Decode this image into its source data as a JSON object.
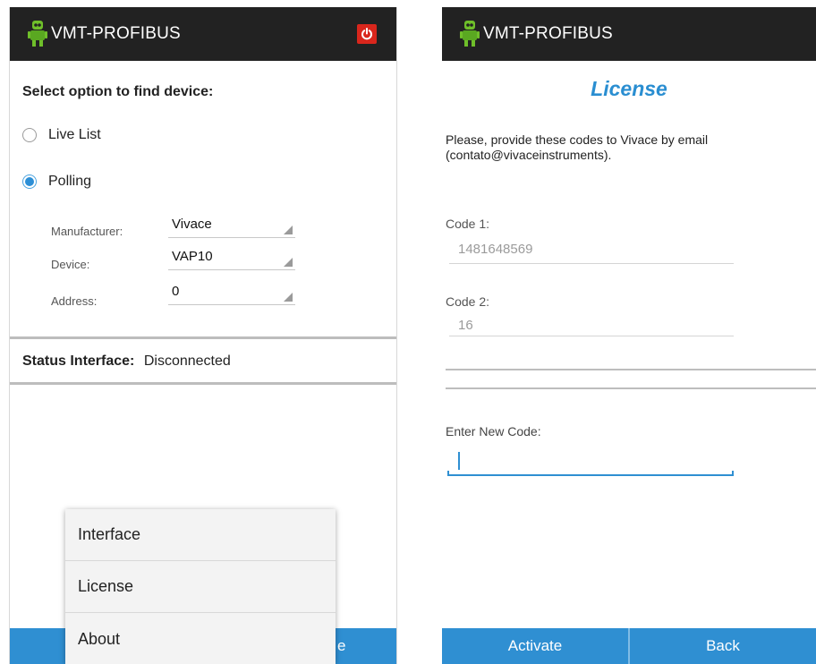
{
  "left_screen": {
    "app_title": "VMT-PROFIBUS",
    "heading": "Select option to find device:",
    "options": [
      {
        "label": "Live List",
        "checked": false
      },
      {
        "label": "Polling",
        "checked": true
      }
    ],
    "fields": {
      "manufacturer": {
        "label": "Manufacturer:",
        "value": "Vivace"
      },
      "device": {
        "label": "Device:",
        "value": "VAP10"
      },
      "address": {
        "label": "Address:",
        "value": "0"
      }
    },
    "status": {
      "label": "Status Interface:",
      "value": "Disconnected"
    },
    "menu": {
      "items": [
        "Interface",
        "License",
        "About"
      ]
    },
    "bottom_bar_text": "e",
    "icons": {
      "logo": "robot-logo-icon",
      "power": "power-icon"
    },
    "colors": {
      "titlebar": "#222222",
      "accent": "#2f8fd2",
      "power": "#d9261c"
    }
  },
  "right_screen": {
    "app_title": "VMT-PROFIBUS",
    "title": "License",
    "intro": "Please, provide these codes to Vivace by email (contato@vivaceinstruments).",
    "code1": {
      "label": "Code 1:",
      "value": "1481648569"
    },
    "code2": {
      "label": "Code 2:",
      "value": "16"
    },
    "new_code": {
      "label": "Enter New Code:",
      "value": ""
    },
    "buttons": {
      "activate": "Activate",
      "back": "Back"
    },
    "icons": {
      "logo": "robot-logo-icon"
    },
    "colors": {
      "title": "#2a8ed1",
      "accent": "#2f8fd2"
    }
  }
}
